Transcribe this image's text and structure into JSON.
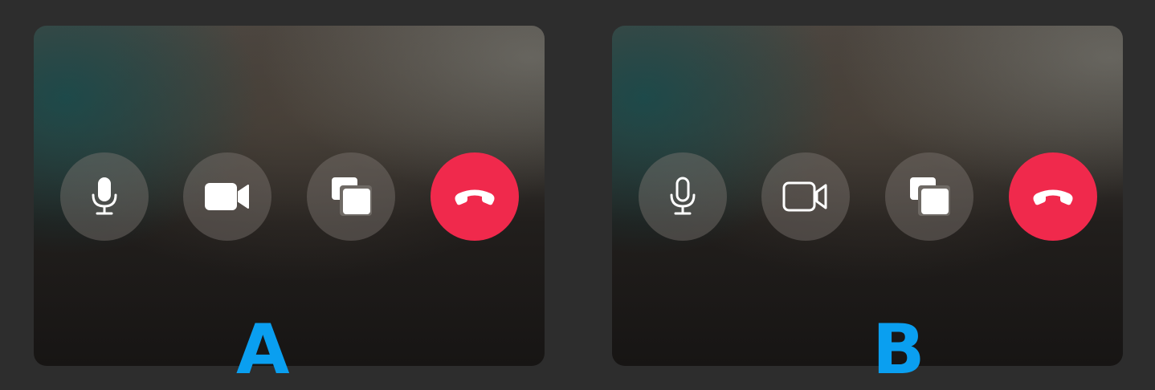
{
  "variants": [
    {
      "id": "A",
      "label": "A",
      "icon_style": "filled",
      "buttons": [
        {
          "icon": "microphone-icon"
        },
        {
          "icon": "video-camera-icon"
        },
        {
          "icon": "share-screen-icon"
        },
        {
          "icon": "end-call-icon"
        }
      ]
    },
    {
      "id": "B",
      "label": "B",
      "icon_style": "outline",
      "buttons": [
        {
          "icon": "microphone-icon"
        },
        {
          "icon": "video-camera-icon"
        },
        {
          "icon": "share-screen-icon"
        },
        {
          "icon": "end-call-icon"
        }
      ]
    }
  ],
  "colors": {
    "background": "#2d2d2d",
    "button": "#827c76",
    "end_call": "#f0294c",
    "label": "#0a9ff0",
    "icon": "#ffffff"
  }
}
